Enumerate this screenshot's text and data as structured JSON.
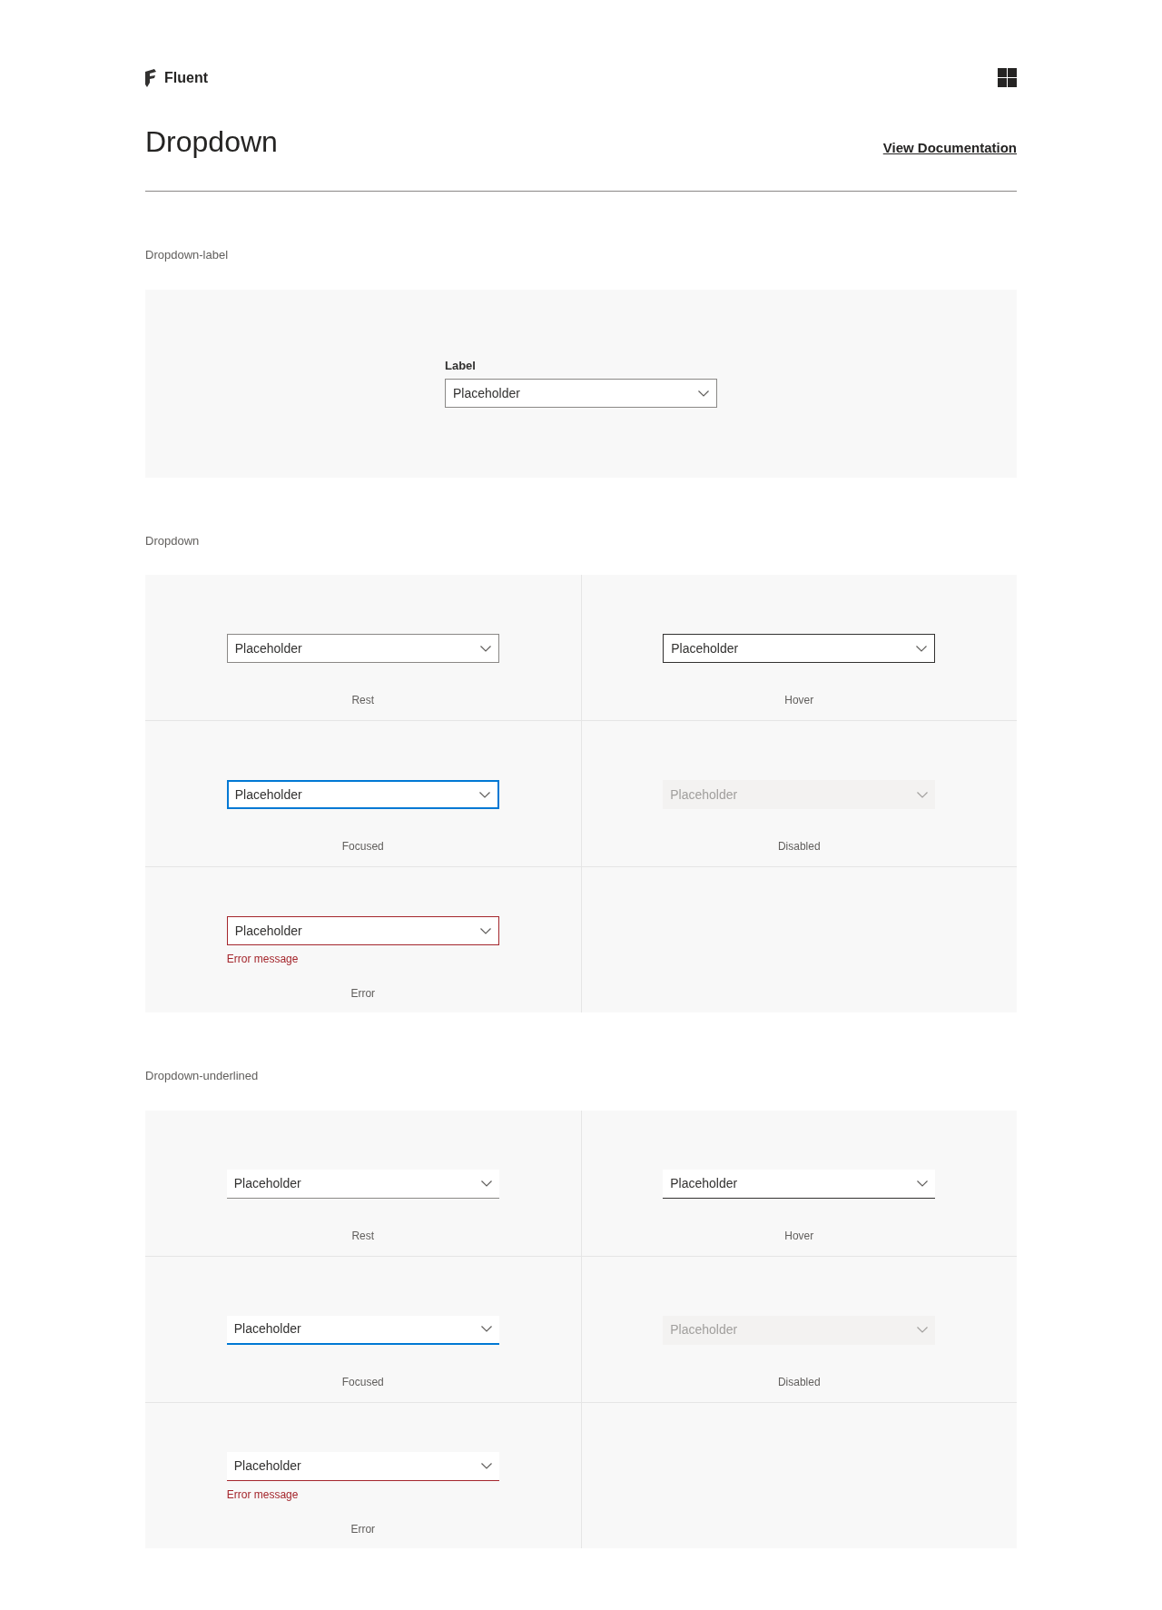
{
  "header": {
    "brand": "Fluent",
    "title": "Dropdown",
    "doc_link": "View Documentation"
  },
  "sections": [
    {
      "title": "Dropdown-label",
      "kind": "labeled",
      "label": "Label",
      "placeholder": "Placeholder"
    },
    {
      "title": "Dropdown",
      "kind": "outlined",
      "cells": [
        {
          "kind": "rest",
          "placeholder": "Placeholder",
          "caption": "Rest"
        },
        {
          "kind": "hover",
          "placeholder": "Placeholder",
          "caption": "Hover"
        },
        {
          "kind": "focused",
          "placeholder": "Placeholder",
          "caption": "Focused"
        },
        {
          "kind": "disabled",
          "placeholder": "Placeholder",
          "caption": "Disabled"
        },
        {
          "kind": "error",
          "placeholder": "Placeholder",
          "caption": "Error",
          "error_message": "Error message"
        }
      ]
    },
    {
      "title": "Dropdown-underlined",
      "kind": "underlined",
      "cells": [
        {
          "kind": "rest",
          "placeholder": "Placeholder",
          "caption": "Rest"
        },
        {
          "kind": "hover",
          "placeholder": "Placeholder",
          "caption": "Hover"
        },
        {
          "kind": "focused",
          "placeholder": "Placeholder",
          "caption": "Focused"
        },
        {
          "kind": "disabled",
          "placeholder": "Placeholder",
          "caption": "Disabled"
        },
        {
          "kind": "error",
          "placeholder": "Placeholder",
          "caption": "Error",
          "error_message": "Error message"
        }
      ]
    }
  ]
}
